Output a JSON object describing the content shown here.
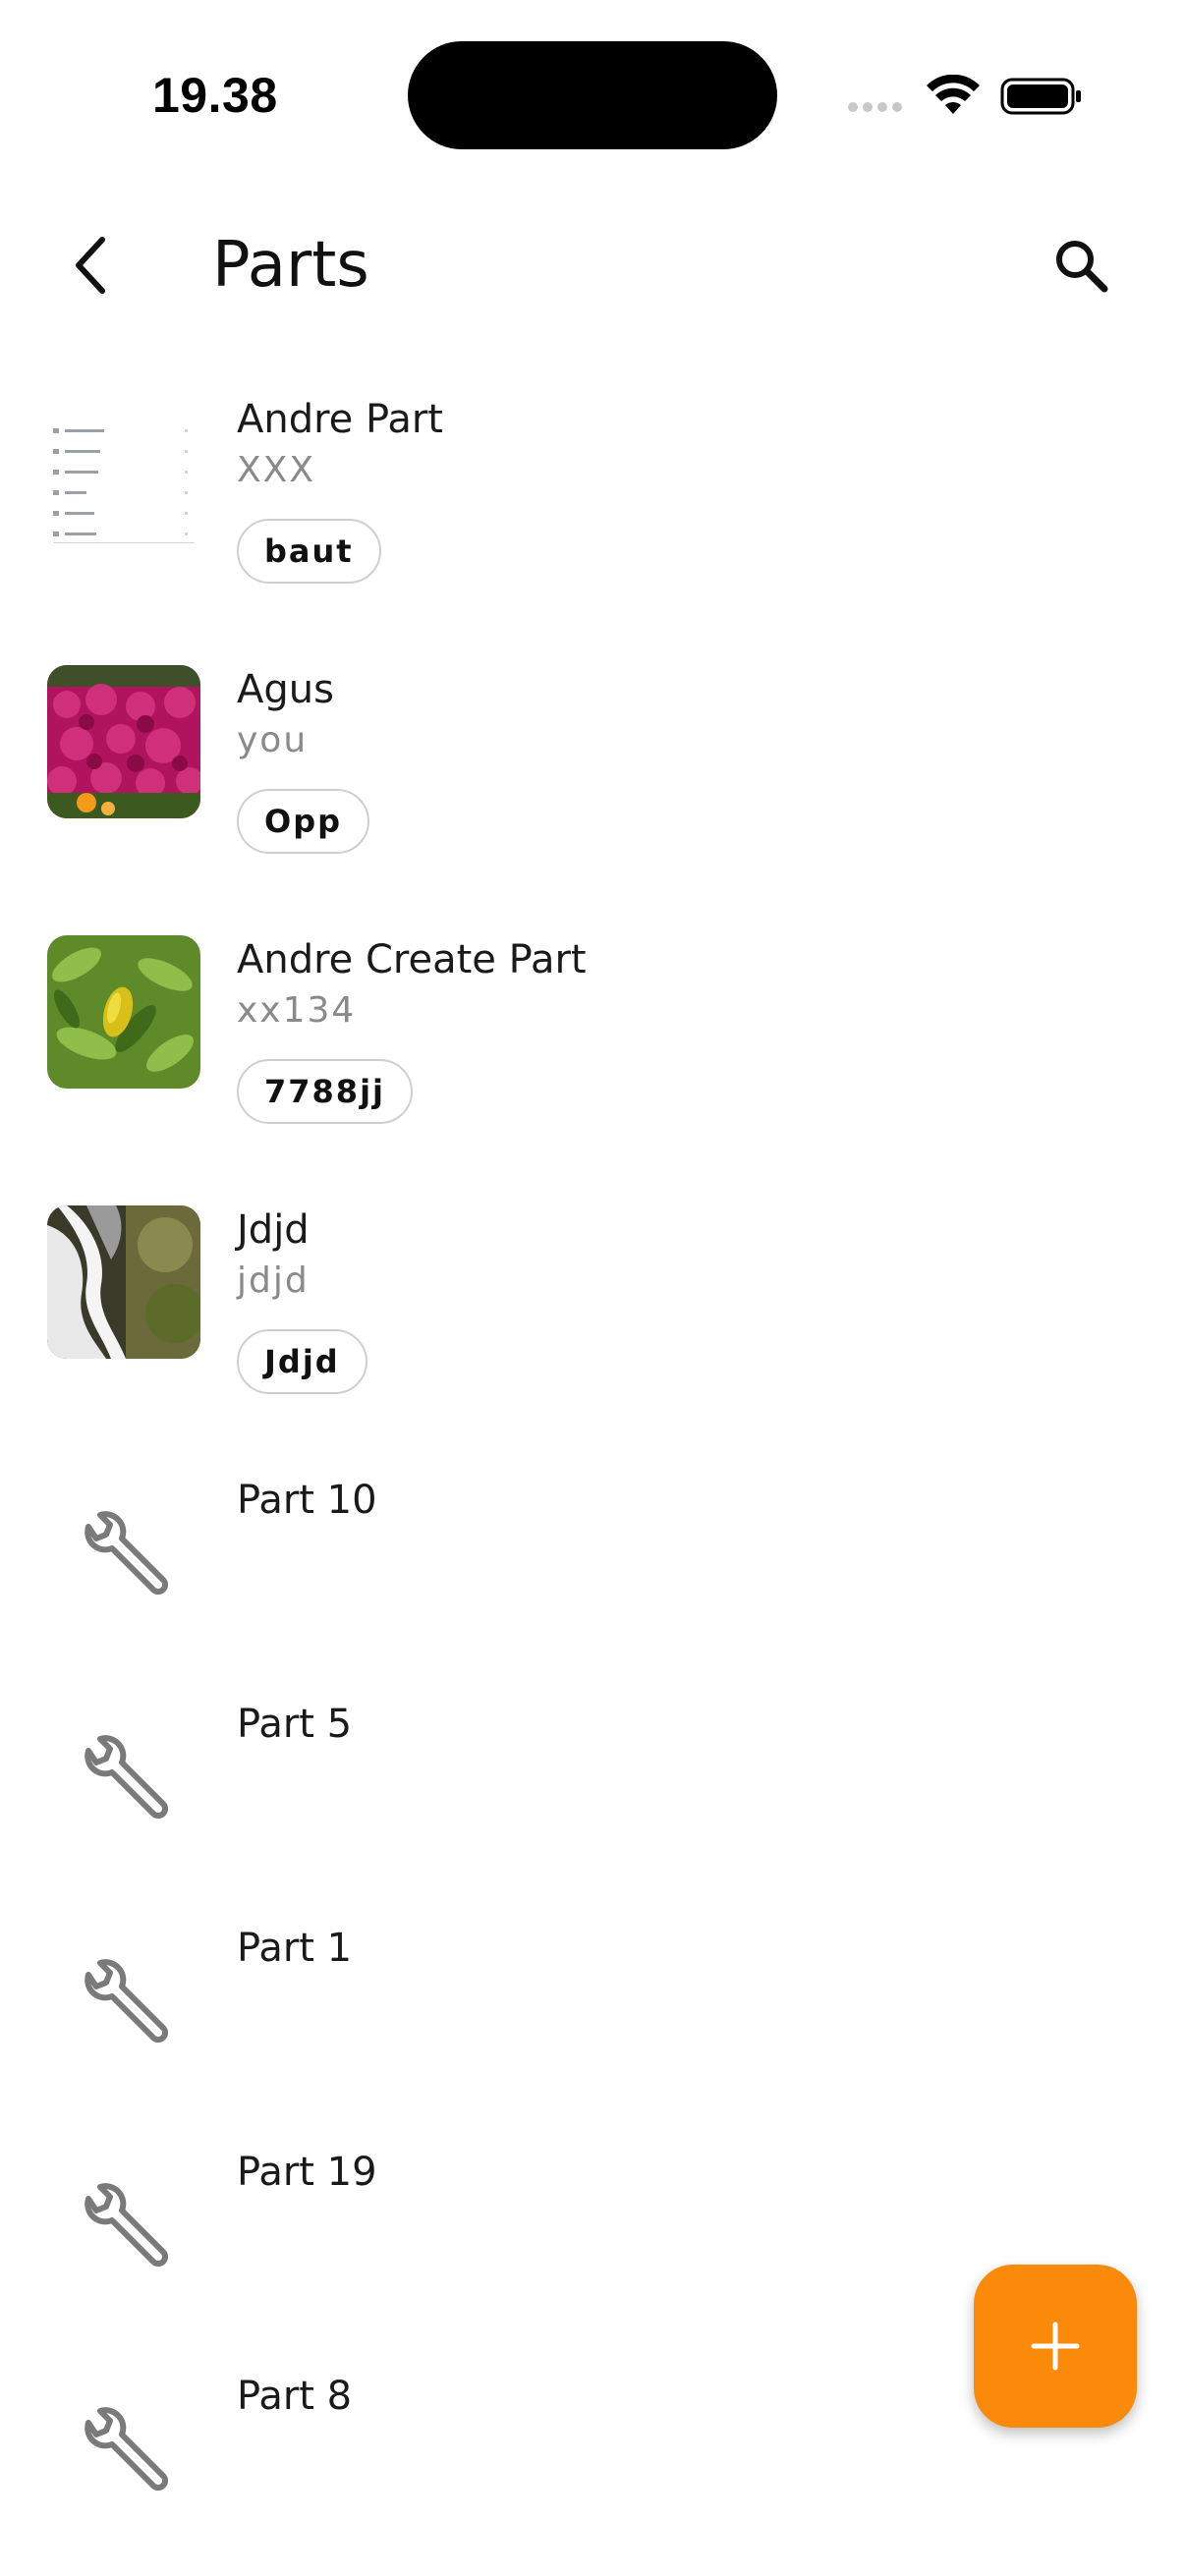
{
  "status_bar": {
    "time": "19.38",
    "icons": [
      "signal-dots-icon",
      "wifi-icon",
      "battery-icon"
    ]
  },
  "header": {
    "back_icon": "chevron-left-icon",
    "title": "Parts",
    "search_icon": "search-icon"
  },
  "parts": [
    {
      "name": "Andre Part",
      "number": "XXX",
      "tag": "baut",
      "thumbnail": "screenshot-image"
    },
    {
      "name": "Agus",
      "number": "you",
      "tag": "Opp",
      "thumbnail": "flowers-image"
    },
    {
      "name": "Andre Create Part",
      "number": "xx134",
      "tag": "7788jj",
      "thumbnail": "leaves-image"
    },
    {
      "name": "Jdjd",
      "number": "jdjd",
      "tag": "Jdjd",
      "thumbnail": "waterfall-image"
    },
    {
      "name": "Part 10",
      "thumbnail": "wrench-icon"
    },
    {
      "name": "Part 5",
      "thumbnail": "wrench-icon"
    },
    {
      "name": "Part 1",
      "thumbnail": "wrench-icon"
    },
    {
      "name": "Part 19",
      "thumbnail": "wrench-icon"
    },
    {
      "name": "Part 8",
      "thumbnail": "wrench-icon"
    }
  ],
  "fab": {
    "icon": "plus-icon"
  },
  "colors": {
    "accent": "#fb8a0a",
    "secondary_text": "#8a8a8a",
    "chip_border": "#cfcfcf",
    "icon_gray": "#7a7a7a"
  }
}
